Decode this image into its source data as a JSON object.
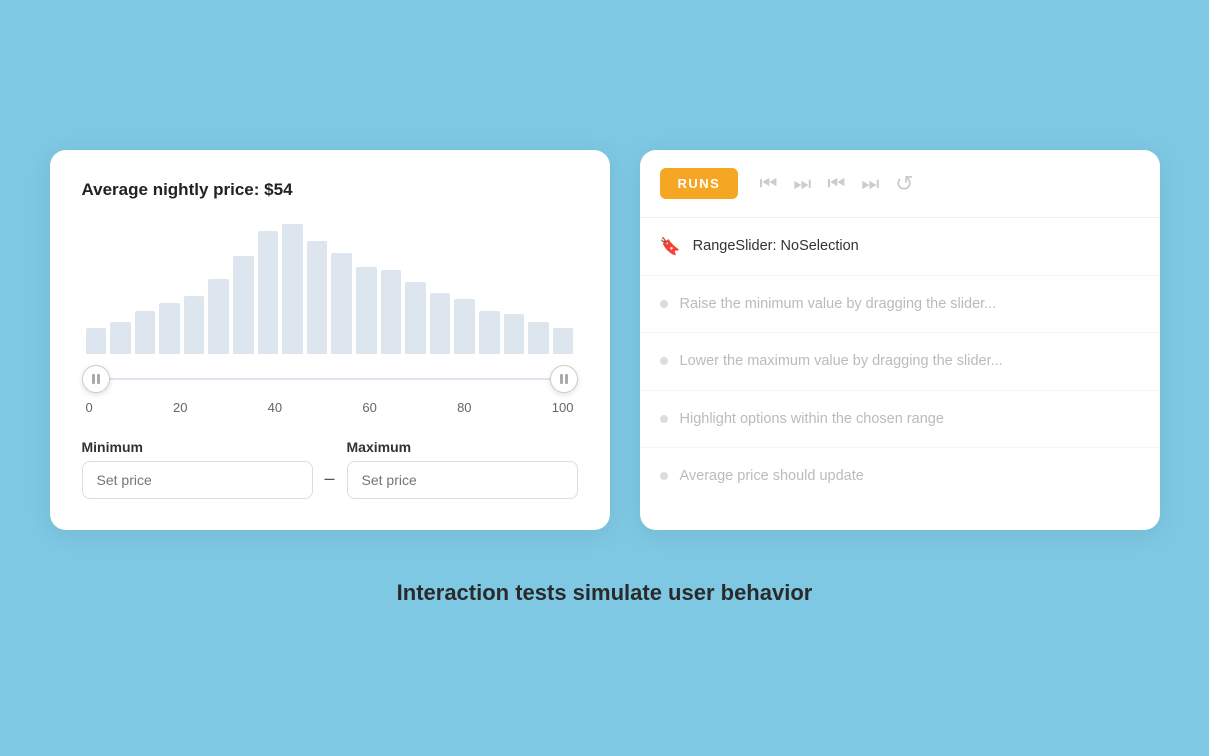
{
  "leftCard": {
    "priceTitle": "Average nightly price: ",
    "priceBold": "$54",
    "minLabel": "Minimum",
    "maxLabel": "Maximum",
    "minPlaceholder": "Set price",
    "maxPlaceholder": "Set price",
    "axisLabels": [
      "0",
      "20",
      "40",
      "60",
      "80",
      "100"
    ],
    "bars": [
      18,
      22,
      30,
      35,
      40,
      52,
      68,
      85,
      90,
      78,
      70,
      60,
      58,
      50,
      42,
      38,
      30,
      28,
      22,
      18
    ]
  },
  "rightCard": {
    "runsLabel": "RUNS",
    "mainTestLabel": "RangeSlider: NoSelection",
    "tests": [
      {
        "text": "Raise the minimum value by dragging the slider...",
        "type": "bullet"
      },
      {
        "text": "Lower the maximum value by dragging the slider...",
        "type": "bullet"
      },
      {
        "text": "Highlight options within the chosen range",
        "type": "bullet"
      },
      {
        "text": "Average price should update",
        "type": "bullet"
      }
    ]
  },
  "bottomLabel": "Interaction tests simulate user behavior"
}
